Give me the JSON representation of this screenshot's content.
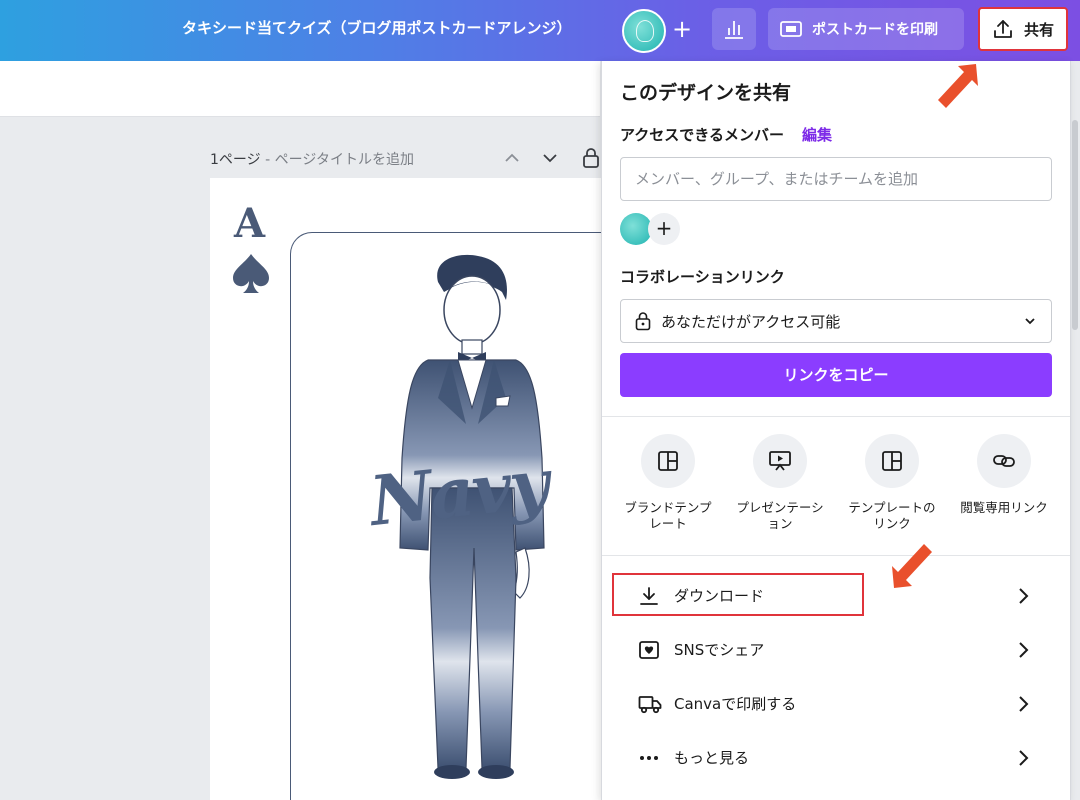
{
  "header": {
    "title": "タキシード当てクイズ（ブログ用ポストカードアレンジ）",
    "plus": "+",
    "print_label": "ポストカードを印刷",
    "share_label": "共有"
  },
  "page": {
    "label": "1ページ",
    "subtitle": " - ページタイトルを追加"
  },
  "card": {
    "rank": "A",
    "script_text": "Navy"
  },
  "share_panel": {
    "title": "このデザインを共有",
    "access_label": "アクセスできるメンバー",
    "edit_link": "編集",
    "member_placeholder": "メンバー、グループ、またはチームを追加",
    "mini_plus": "+",
    "collab_label": "コラボレーションリンク",
    "collab_value": "あなただけがアクセス可能",
    "copy_button": "リンクをコピー",
    "options": [
      {
        "label": "ブランドテンプ\nレート",
        "icon": "template-icon"
      },
      {
        "label": "プレゼンテーシ\nョン",
        "icon": "presentation-icon"
      },
      {
        "label": "テンプレートの\nリンク",
        "icon": "template-link-icon"
      },
      {
        "label": "閲覧専用リンク",
        "icon": "link-icon"
      }
    ],
    "list": [
      {
        "label": "ダウンロード",
        "icon": "download-icon"
      },
      {
        "label": "SNSでシェア",
        "icon": "heart-icon"
      },
      {
        "label": "Canvaで印刷する",
        "icon": "truck-icon"
      },
      {
        "label": "もっと見る",
        "icon": "more-icon"
      }
    ]
  },
  "colors": {
    "accent_purple": "#8b3dff",
    "highlight_red": "#e0343b",
    "card_ink": "#4a5a77"
  }
}
